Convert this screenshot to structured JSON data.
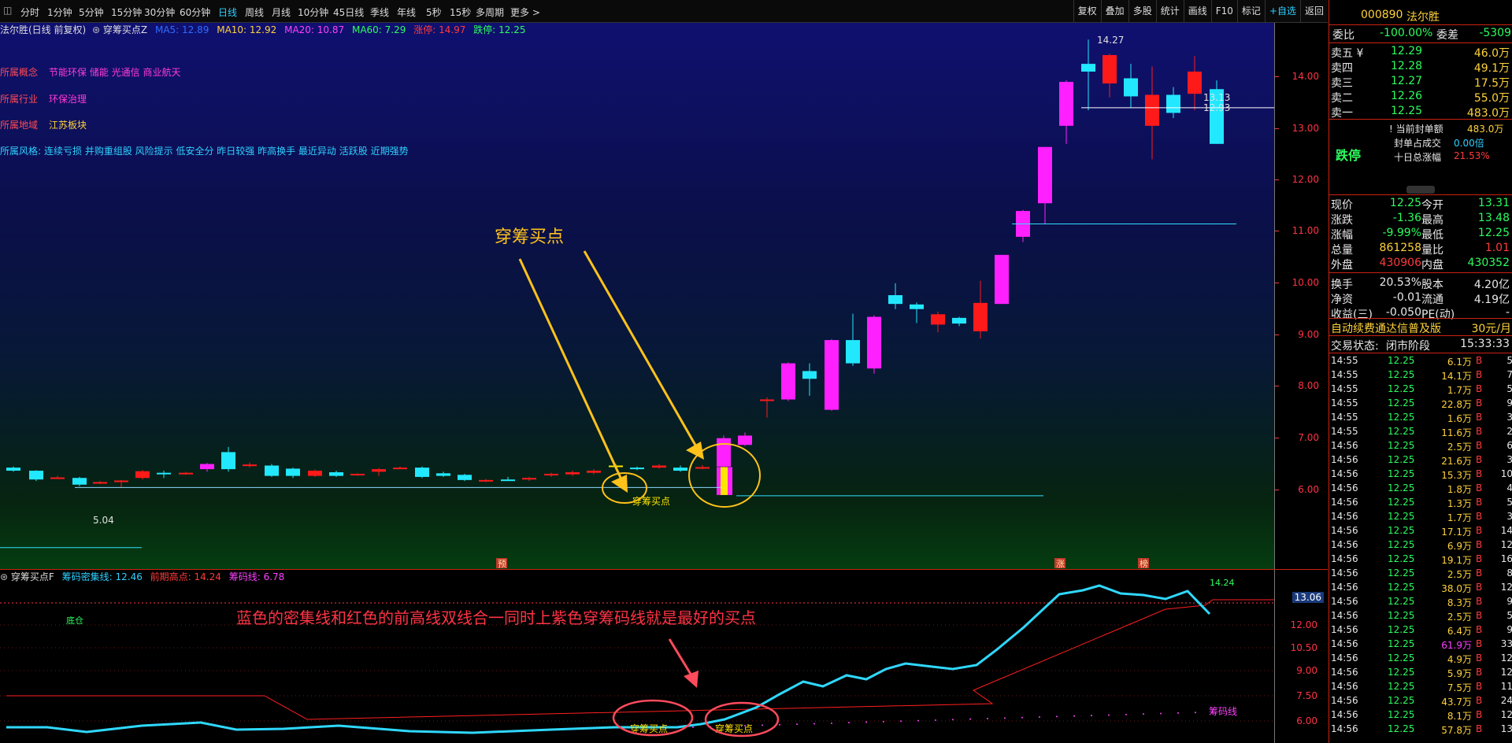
{
  "toolbar": {
    "tabs": [
      "分时",
      "1分钟",
      "5分钟",
      "15分钟",
      "30分钟",
      "60分钟",
      "日线",
      "周线",
      "月线",
      "10分钟",
      "45日线",
      "季线",
      "年线",
      "5秒",
      "15秒",
      "多周期",
      "更多 >"
    ],
    "active": "日线",
    "right_buttons": [
      "复权",
      "叠加",
      "多股",
      "统计",
      "画线",
      "F10",
      "标记",
      "+自选",
      "返回"
    ]
  },
  "chart_header": {
    "stock": "法尔胜(日线 前复权)",
    "indicator": "穿筹买点Z",
    "ma5": "MA5: 12.89",
    "ma10": "MA10: 12.92",
    "ma20": "MA20: 10.87",
    "ma60": "MA60: 7.29",
    "up_limit": "涨停: 14.97",
    "down_limit": "跌停: 12.25"
  },
  "stock_info": [
    {
      "k": "所属概念",
      "v": "节能环保 储能 光通信 商业航天"
    },
    {
      "k": "所属行业",
      "v": "环保治理"
    },
    {
      "k": "所属地域",
      "v": "江苏板块"
    },
    {
      "k": "所属风格:",
      "v": "连续亏损 并购重组股 风险提示 低安全分 昨日较强 昨高换手 最近异动 活跃股 近期强势"
    }
  ],
  "annotations": {
    "buy_title": "穿筹买点",
    "buy_label": "穿筹买点",
    "high": "14.27",
    "low": "5.04",
    "mark_a": "预",
    "mark_b": "涨",
    "mark_c": "榜",
    "price_a": "13.13",
    "price_b": "12.93"
  },
  "price_axis": [
    "14.00",
    "13.00",
    "12.00",
    "11.00",
    "10.00",
    "9.00",
    "8.00",
    "7.00",
    "6.00"
  ],
  "indicator": {
    "name": "穿筹买点F",
    "density": "筹码密集线: 12.46",
    "prev_high": "前期高点: 14.24",
    "chip": "筹码线: 6.78",
    "tag": "底仓",
    "caption": "蓝色的密集线和红色的前高线双线合一同时上紫色穿筹码线就是最好的买点",
    "buy1": "穿筹买点",
    "buy2": "穿筹买点",
    "chip_label": "筹码线",
    "top_value": "14.24",
    "current": "13.06",
    "axis": [
      "12.00",
      "10.50",
      "9.00",
      "7.50",
      "6.00"
    ]
  },
  "quote": {
    "code": "000890",
    "name": "法尔胜",
    "weibi_label": "委比",
    "weibi": "-100.00%",
    "weicha_label": "委差",
    "weicha": "-5309",
    "asks": [
      {
        "l": "卖五 ¥",
        "p": "12.29",
        "v": "46.0万"
      },
      {
        "l": "卖四",
        "p": "12.28",
        "v": "49.1万"
      },
      {
        "l": "卖三",
        "p": "12.27",
        "v": "17.5万"
      },
      {
        "l": "卖二",
        "p": "12.26",
        "v": "55.0万"
      },
      {
        "l": "卖一",
        "p": "12.25",
        "v": "483.0万"
      }
    ],
    "status": "跌停",
    "seal_label": "! 当前封单额",
    "seal": "483.0万",
    "seal_deal_label": "封单占成交",
    "seal_deal": "0.00倍",
    "ten_day_label": "十日总涨幅",
    "ten_day": "21.53%",
    "stats": [
      {
        "a": "现价",
        "av": "12.25",
        "b": "今开",
        "bv": "13.31",
        "ac": "grn",
        "bc": "grn"
      },
      {
        "a": "涨跌",
        "av": "-1.36",
        "b": "最高",
        "bv": "13.48",
        "ac": "grn",
        "bc": "grn"
      },
      {
        "a": "涨幅",
        "av": "-9.99%",
        "b": "最低",
        "bv": "12.25",
        "ac": "grn",
        "bc": "grn"
      },
      {
        "a": "总量",
        "av": "861258",
        "b": "量比",
        "bv": "1.01",
        "ac": "yel",
        "bc": "red"
      },
      {
        "a": "外盘",
        "av": "430906",
        "b": "内盘",
        "bv": "430352",
        "ac": "red",
        "bc": "grn"
      },
      {
        "a": "换手",
        "av": "20.53%",
        "b": "股本",
        "bv": "4.20亿",
        "ac": "wh",
        "bc": "wh"
      },
      {
        "a": "净资",
        "av": "-0.01",
        "b": "流通",
        "bv": "4.19亿",
        "ac": "wh",
        "bc": "wh"
      },
      {
        "a": "收益(三)",
        "av": "-0.050",
        "b": "PE(动)",
        "bv": "-",
        "ac": "wh",
        "bc": "wh"
      }
    ],
    "fee_label": "自动续费通达信普及版",
    "fee": "30元/月",
    "trade_status_label": "交易状态:",
    "trade_status": "闭市阶段",
    "time": "15:33:33",
    "ticks": [
      [
        "14:55",
        "12.25",
        "6.1万",
        "B",
        "5"
      ],
      [
        "14:55",
        "12.25",
        "14.1万",
        "B",
        "7"
      ],
      [
        "14:55",
        "12.25",
        "1.7万",
        "B",
        "5"
      ],
      [
        "14:55",
        "12.25",
        "22.8万",
        "B",
        "9"
      ],
      [
        "14:55",
        "12.25",
        "1.6万",
        "B",
        "3"
      ],
      [
        "14:55",
        "12.25",
        "11.6万",
        "B",
        "2"
      ],
      [
        "14:56",
        "12.25",
        "2.5万",
        "B",
        "6"
      ],
      [
        "14:56",
        "12.25",
        "21.6万",
        "B",
        "3"
      ],
      [
        "14:56",
        "12.25",
        "15.3万",
        "B",
        "10"
      ],
      [
        "14:56",
        "12.25",
        "1.8万",
        "B",
        "4"
      ],
      [
        "14:56",
        "12.25",
        "1.3万",
        "B",
        "5"
      ],
      [
        "14:56",
        "12.25",
        "1.7万",
        "B",
        "3"
      ],
      [
        "14:56",
        "12.25",
        "17.1万",
        "B",
        "14"
      ],
      [
        "14:56",
        "12.25",
        "6.9万",
        "B",
        "12"
      ],
      [
        "14:56",
        "12.25",
        "19.1万",
        "B",
        "16"
      ],
      [
        "14:56",
        "12.25",
        "2.5万",
        "B",
        "8"
      ],
      [
        "14:56",
        "12.25",
        "38.0万",
        "B",
        "12"
      ],
      [
        "14:56",
        "12.25",
        "8.3万",
        "B",
        "9"
      ],
      [
        "14:56",
        "12.25",
        "2.5万",
        "B",
        "5"
      ],
      [
        "14:56",
        "12.25",
        "6.4万",
        "B",
        "9"
      ],
      [
        "14:56",
        "12.25",
        "61.9万",
        "B",
        "33"
      ],
      [
        "14:56",
        "12.25",
        "4.9万",
        "B",
        "12"
      ],
      [
        "14:56",
        "12.25",
        "5.9万",
        "B",
        "12"
      ],
      [
        "14:56",
        "12.25",
        "7.5万",
        "B",
        "11"
      ],
      [
        "14:56",
        "12.25",
        "43.7万",
        "B",
        "24"
      ],
      [
        "14:56",
        "12.25",
        "8.1万",
        "B",
        "12"
      ],
      [
        "14:56",
        "12.25",
        "57.8万",
        "B",
        "13"
      ]
    ]
  }
}
